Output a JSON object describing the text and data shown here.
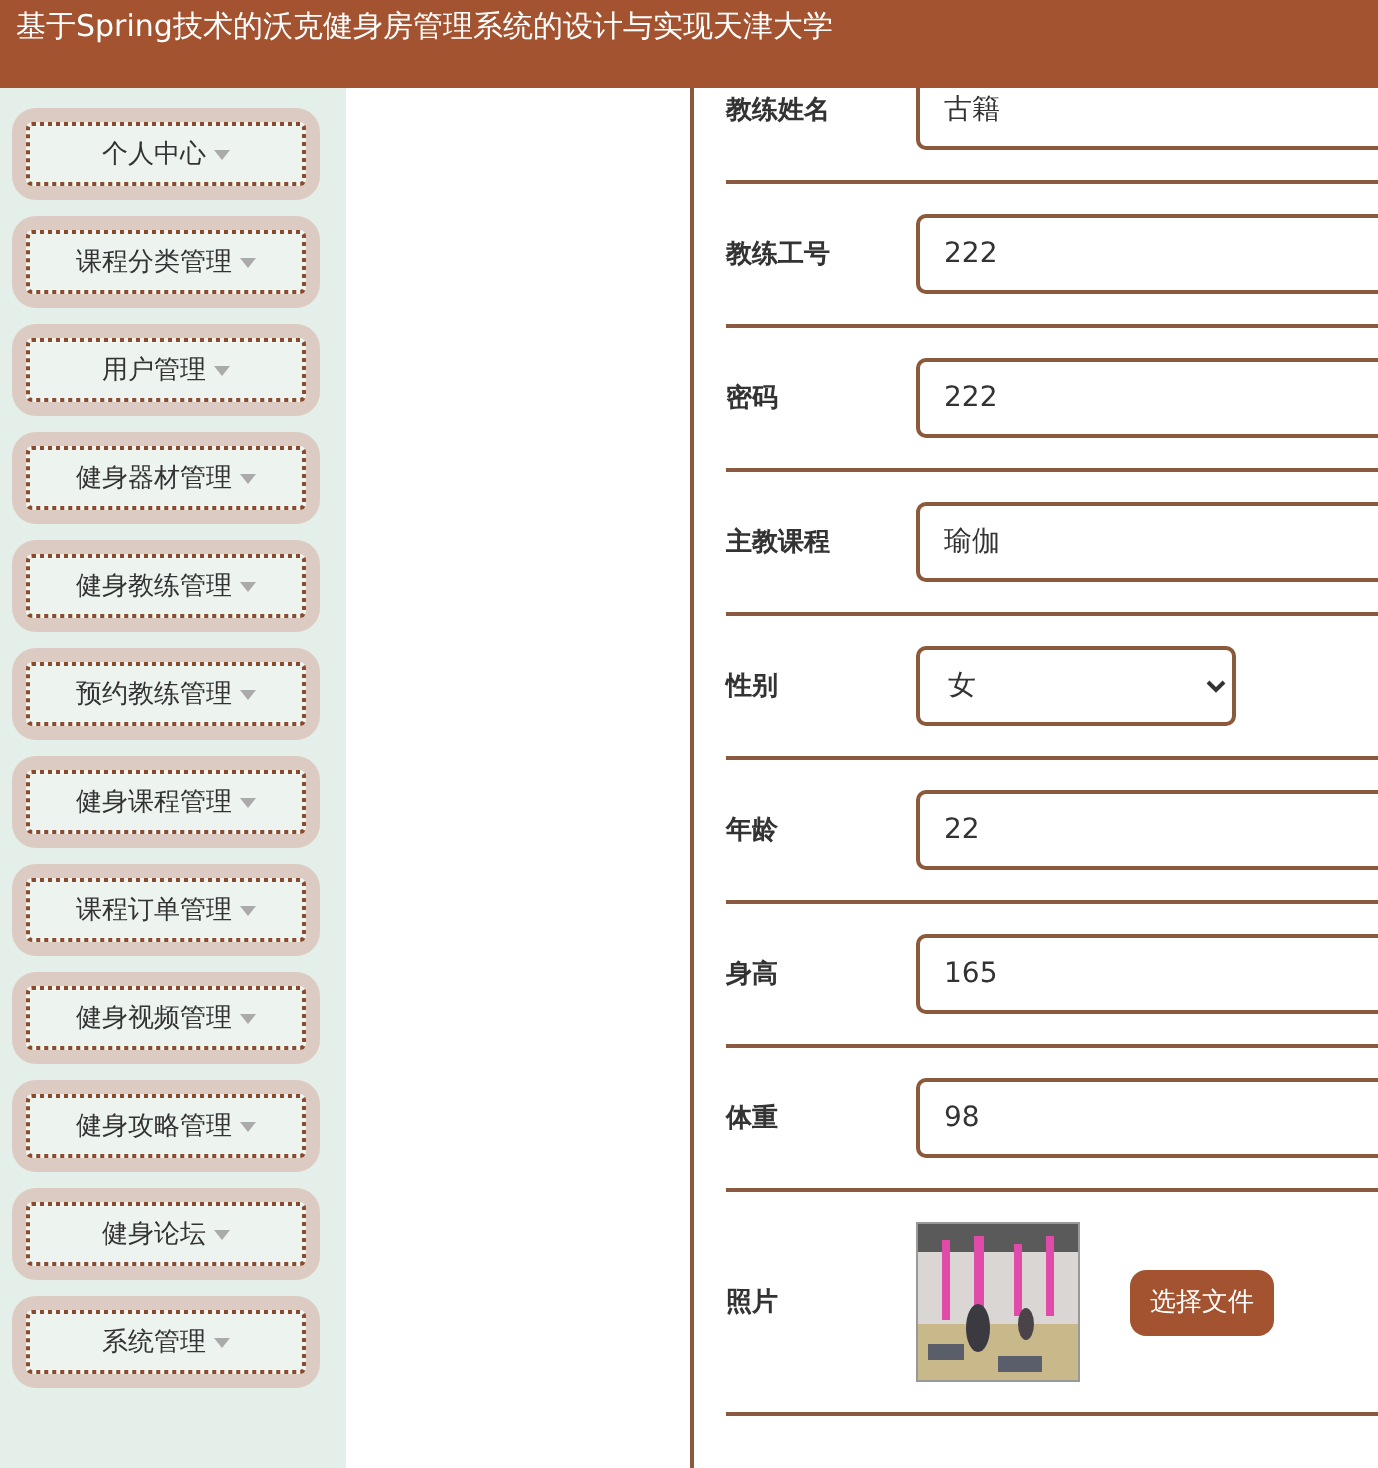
{
  "header": {
    "title": "基于Spring技术的沃克健身房管理系统的设计与实现天津大学"
  },
  "sidebar": {
    "items": [
      {
        "label": "个人中心"
      },
      {
        "label": "课程分类管理"
      },
      {
        "label": "用户管理"
      },
      {
        "label": "健身器材管理"
      },
      {
        "label": "健身教练管理"
      },
      {
        "label": "预约教练管理"
      },
      {
        "label": "健身课程管理"
      },
      {
        "label": "课程订单管理"
      },
      {
        "label": "健身视频管理"
      },
      {
        "label": "健身攻略管理"
      },
      {
        "label": "健身论坛"
      },
      {
        "label": "系统管理"
      }
    ]
  },
  "form": {
    "fields": [
      {
        "kind": "text",
        "label": "教练姓名",
        "value": "古籍"
      },
      {
        "kind": "text",
        "label": "教练工号",
        "value": "222"
      },
      {
        "kind": "text",
        "label": "密码",
        "value": "222"
      },
      {
        "kind": "text",
        "label": "主教课程",
        "value": "瑜伽"
      },
      {
        "kind": "select",
        "label": "性别",
        "value": "女"
      },
      {
        "kind": "text",
        "label": "年龄",
        "value": "22"
      },
      {
        "kind": "text",
        "label": "身高",
        "value": "165"
      },
      {
        "kind": "text",
        "label": "体重",
        "value": "98"
      },
      {
        "label": "照片",
        "button": "选择文件"
      }
    ]
  }
}
